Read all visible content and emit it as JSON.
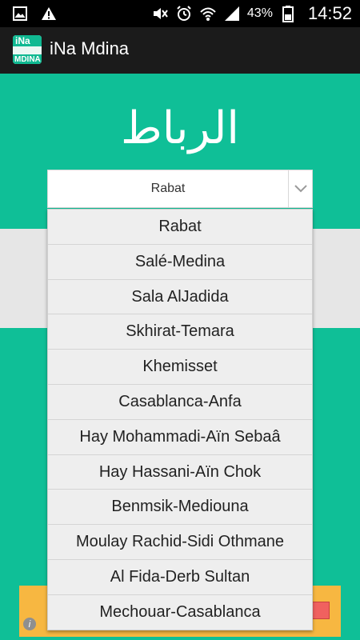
{
  "status_bar": {
    "battery_percent": "43%",
    "time": "14:52",
    "icons": [
      "gallery-icon",
      "warning-icon",
      "mute-icon",
      "alarm-icon",
      "wifi-icon",
      "signal-icon",
      "battery-icon"
    ]
  },
  "app": {
    "title": "iNa Mdina",
    "icon_text_top": "iNa",
    "icon_text_bottom": "MDINA"
  },
  "header": {
    "arabic_title": "الرباط"
  },
  "spinner": {
    "selected": "Rabat"
  },
  "dropdown": {
    "items": [
      {
        "label": "Rabat"
      },
      {
        "label": "Salé-Medina"
      },
      {
        "label": "Sala AlJadida"
      },
      {
        "label": "Skhirat-Temara"
      },
      {
        "label": "Khemisset"
      },
      {
        "label": "Casablanca-Anfa"
      },
      {
        "label": "Hay Mohammadi-Aïn Sebaâ"
      },
      {
        "label": "Hay Hassani-Aïn Chok"
      },
      {
        "label": "Benmsik-Mediouna"
      },
      {
        "label": "Moulay Rachid-Sidi Othmane"
      },
      {
        "label": "Al Fida-Derb Sultan"
      },
      {
        "label": "Mechouar-Casablanca"
      }
    ]
  },
  "ad": {
    "info_symbol": "i"
  },
  "colors": {
    "background": "#0fbf97",
    "action_bar": "#1b1b1b",
    "status_bar": "#000000",
    "ad_banner": "#f7b741"
  }
}
